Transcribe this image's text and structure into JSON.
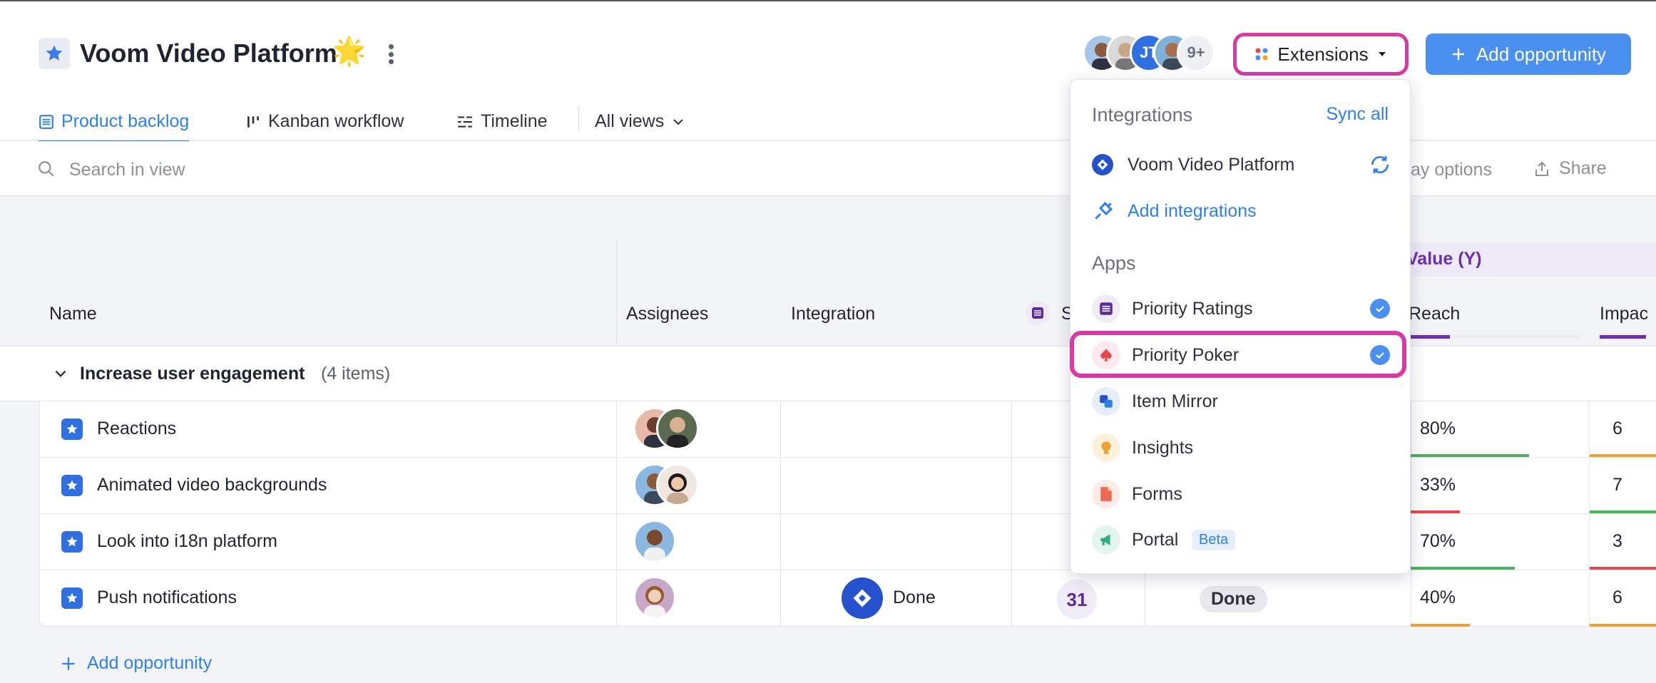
{
  "project": {
    "title": "Voom Video Platform",
    "sparkle": "🌟"
  },
  "tabs": [
    {
      "label": "Product backlog",
      "active": true
    },
    {
      "label": "Kanban workflow",
      "active": false
    },
    {
      "label": "Timeline",
      "active": false
    },
    {
      "label": "All views",
      "active": false
    }
  ],
  "members": {
    "avatar_initials": "JT",
    "more_count": "9+"
  },
  "toolbar": {
    "extensions_label": "Extensions",
    "add_opportunity_label": "Add opportunity"
  },
  "search": {
    "placeholder": "Search in view",
    "display_options_label": "ay options",
    "share_label": "Share"
  },
  "columns": {
    "name": "Name",
    "assignees": "Assignees",
    "integration": "Integration",
    "score_partial": "S",
    "value_group": "Value (Y)",
    "reach": "Reach",
    "impact": "Impac"
  },
  "group": {
    "name": "Increase user engagement",
    "count": "(4 items)"
  },
  "rows": [
    {
      "name": "Reactions",
      "reach": "80%",
      "reach_fill": 0.8,
      "reach_color": "#4bb35a",
      "impact": "6",
      "impact_color": "#f0a030"
    },
    {
      "name": "Animated video backgrounds",
      "reach": "33%",
      "reach_fill": 0.33,
      "reach_color": "#e5484d",
      "impact": "7",
      "impact_color": "#4bb35a"
    },
    {
      "name": "Look into i18n platform",
      "reach": "70%",
      "reach_fill": 0.7,
      "reach_color": "#4bb35a",
      "impact": "3",
      "impact_color": "#e5484d"
    },
    {
      "name": "Push notifications",
      "integration": "Done",
      "score": "31",
      "status": "Done",
      "reach": "40%",
      "reach_fill": 0.4,
      "reach_color": "#f0a030",
      "impact": "6",
      "impact_color": "#f0a030"
    }
  ],
  "footer": {
    "add_opportunity_label": "Add opportunity"
  },
  "dropdown": {
    "integrations_heading": "Integrations",
    "sync_all": "Sync all",
    "integrations": [
      {
        "label": "Voom Video Platform"
      },
      {
        "label": "Add integrations"
      }
    ],
    "apps_heading": "Apps",
    "apps": [
      {
        "label": "Priority Ratings",
        "checked": true
      },
      {
        "label": "Priority Poker",
        "checked": true
      },
      {
        "label": "Item Mirror",
        "checked": false
      },
      {
        "label": "Insights",
        "checked": false
      },
      {
        "label": "Forms",
        "checked": false
      },
      {
        "label": "Portal",
        "checked": false,
        "badge": "Beta"
      }
    ]
  },
  "colors": {
    "accent": "#2f80ed",
    "highlight": "#d63aa5",
    "value_purple": "#6b2fb0"
  }
}
